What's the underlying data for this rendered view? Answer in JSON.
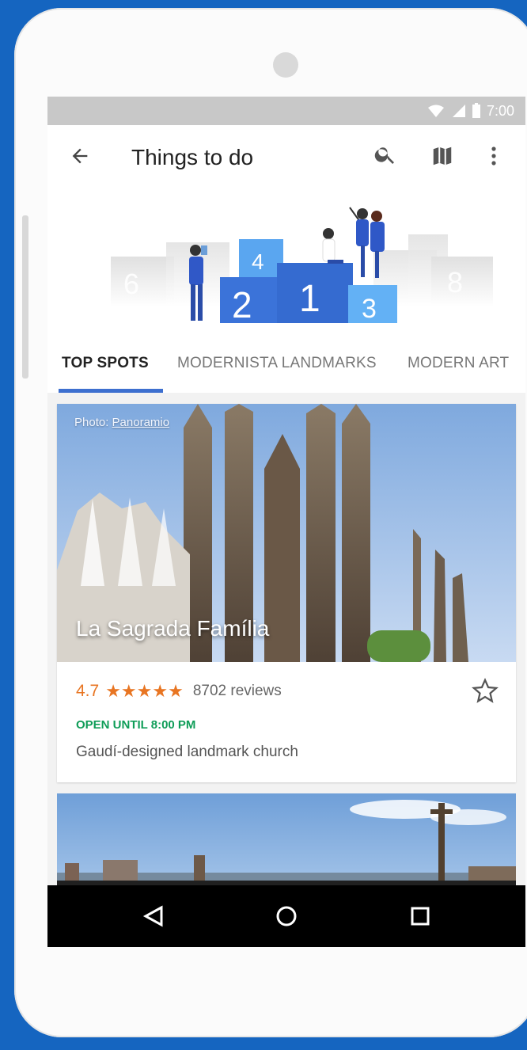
{
  "status": {
    "time": "7:00"
  },
  "toolbar": {
    "title": "Things to do",
    "icons": {
      "back": "arrow-back-icon",
      "search": "search-icon",
      "map": "map-icon",
      "more": "more-vert-icon"
    }
  },
  "hero": {
    "podium_numbers": [
      "6",
      "4",
      "2",
      "1",
      "3",
      "8"
    ]
  },
  "tabs": [
    {
      "label": "TOP SPOTS",
      "active": true
    },
    {
      "label": "MODERNISTA LANDMARKS",
      "active": false
    },
    {
      "label": "MODERN ART",
      "active": false
    }
  ],
  "card": {
    "photo_credit_prefix": "Photo:",
    "photo_credit_link": "Panoramio",
    "place_name": "La Sagrada Família",
    "rating": "4.7",
    "stars": "★★★★★",
    "reviews": "8702 reviews",
    "hours": "OPEN UNTIL 8:00 PM",
    "description": "Gaudí-designed landmark church"
  },
  "colors": {
    "accent": "#3d6fcf",
    "rating": "#e87522",
    "open": "#0f9d58",
    "background": "#1565c0"
  },
  "navigation": {
    "back": "triangle-back-icon",
    "home": "circle-home-icon",
    "recents": "square-recents-icon"
  }
}
